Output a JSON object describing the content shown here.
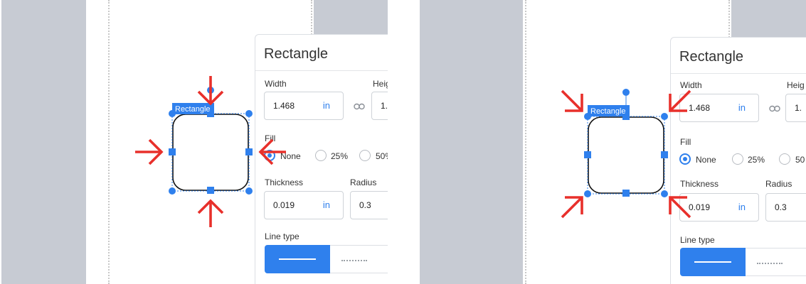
{
  "panels": [
    {
      "variant": "edge-handles",
      "shape_label": "Rectangle",
      "properties": {
        "title": "Rectangle",
        "width_label": "Width",
        "width_value": "1.468",
        "width_unit": "in",
        "height_label": "Heig",
        "height_value": "1.",
        "fill_label": "Fill",
        "fill_options": [
          "None",
          "25%",
          "50%"
        ],
        "fill_selected": "None",
        "thickness_label": "Thickness",
        "thickness_value": "0.019",
        "thickness_unit": "in",
        "radius_label": "Radius",
        "radius_value": "0.3",
        "line_type_label": "Line type"
      }
    },
    {
      "variant": "corner-handles",
      "shape_label": "Rectangle",
      "properties": {
        "title": "Rectangle",
        "width_label": "Width",
        "width_value": "1.468",
        "width_unit": "in",
        "height_label": "Heig",
        "height_value": "1.",
        "fill_label": "Fill",
        "fill_options": [
          "None",
          "25%",
          "50"
        ],
        "fill_selected": "None",
        "thickness_label": "Thickness",
        "thickness_value": "0.019",
        "thickness_unit": "in",
        "radius_label": "Radius",
        "radius_value": "0.3",
        "line_type_label": "Line type"
      }
    }
  ],
  "colors": {
    "accent": "#2f80ed",
    "arrow": "#e8302b",
    "canvas_gray": "#c7cbd3"
  },
  "icons": [
    "link-icon",
    "arrow-icon"
  ]
}
